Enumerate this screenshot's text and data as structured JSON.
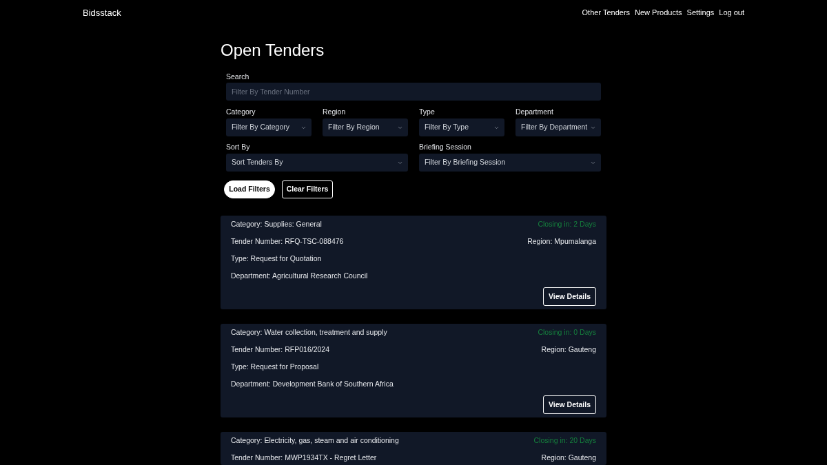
{
  "nav": {
    "brand": "Bidsstack",
    "links": [
      "Other Tenders",
      "New Products",
      "Settings",
      "Log out"
    ]
  },
  "page_title": "Open Tenders",
  "search": {
    "label": "Search",
    "placeholder": "Filter By Tender Number"
  },
  "filters_row_1": [
    {
      "label": "Category",
      "placeholder": "Filter By Category"
    },
    {
      "label": "Region",
      "placeholder": "Filter By Region"
    },
    {
      "label": "Type",
      "placeholder": "Filter By Type"
    },
    {
      "label": "Department",
      "placeholder": "Filter By Department"
    }
  ],
  "filters_row_2": [
    {
      "label": "Sort By",
      "placeholder": "Sort Tenders By"
    },
    {
      "label": "Briefing Session",
      "placeholder": "Filter By Briefing Session"
    }
  ],
  "buttons": [
    {
      "label": "Load Filters",
      "kind": "primary"
    },
    {
      "label": "Clear Filters",
      "kind": "outline"
    }
  ],
  "tenders": [
    {
      "category": "Category: Supplies: General",
      "closing": "Closing in: 2 Days",
      "tender_number": "Tender Number: RFQ-TSC-088476",
      "region": "Region: Mpumalanga",
      "type": "Type: Request for Quotation",
      "department": "Department: Agricultural Research Council",
      "button": "View Details"
    },
    {
      "category": "Category: Water collection, treatment and supply",
      "closing": "Closing in: 0 Days",
      "tender_number": "Tender Number: RFP016/2024",
      "region": "Region: Gauteng",
      "type": "Type: Request for Proposal",
      "department": "Department: Development Bank of Southern Africa",
      "button": "View Details"
    },
    {
      "category": "Category: Electricity, gas, steam and air conditioning",
      "closing": "Closing in: 20 Days",
      "tender_number": "Tender Number: MWP1934TX - Regret Letter",
      "region": "Region: Gauteng"
    }
  ]
}
